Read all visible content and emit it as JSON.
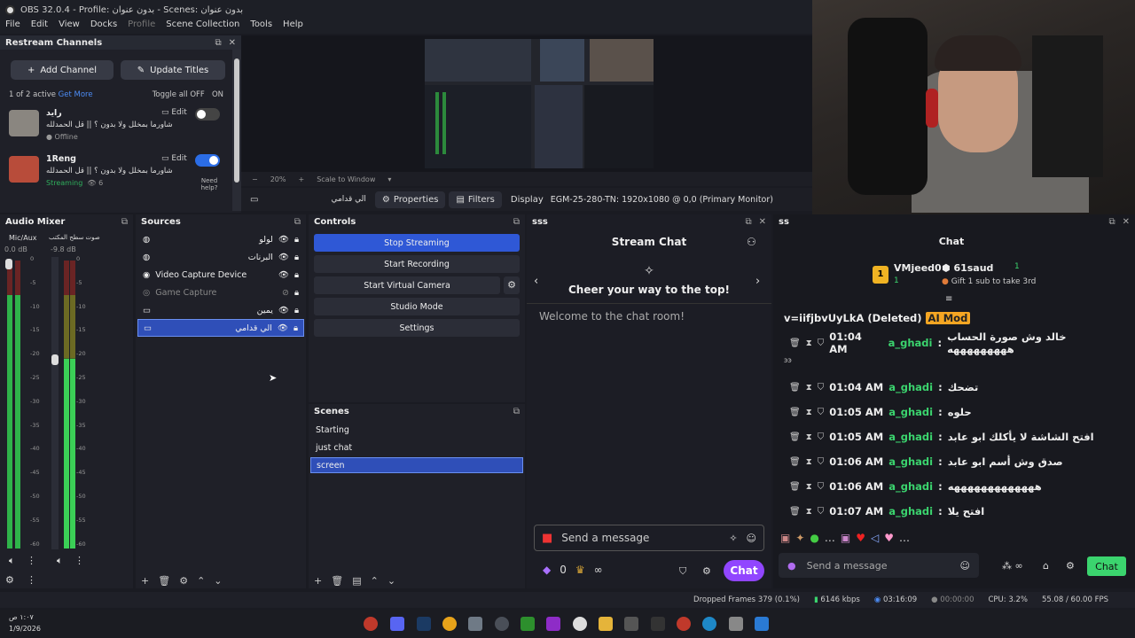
{
  "window": {
    "title": "OBS 32.0.4 - Profile: بدون عنوان - Scenes: بدون عنوان"
  },
  "menu": [
    "File",
    "Edit",
    "View",
    "Docks",
    "Profile",
    "Scene Collection",
    "Tools",
    "Help"
  ],
  "restream": {
    "title": "Restream Channels",
    "add_channel": "Add Channel",
    "update_titles": "Update Titles",
    "active_text": "1 of 2 active",
    "get_more": "Get More",
    "toggle_all": "Toggle all OFF",
    "toggle_on": "ON",
    "channels": [
      {
        "name": "رايد",
        "title": "شاورما بمخلل ولا بدون ؟ || قل الحمدلله",
        "status": "Offline",
        "edit": "Edit",
        "on": false
      },
      {
        "name": "1Reng",
        "title": "شاورما بمخلل ولا بدون ؟ || قل الحمدلله",
        "status": "Streaming",
        "viewers": "6",
        "edit": "Edit",
        "on": true,
        "help": "Need help?"
      }
    ]
  },
  "preview": {
    "zoom": "20%",
    "scale": "Scale to Window",
    "source_name": "الي قدامي",
    "properties": "Properties",
    "filters": "Filters",
    "display_label": "Display",
    "display_value": "EGM-25-280-TN: 1920x1080 @ 0,0 (Primary Monitor)"
  },
  "audio_mixer": {
    "title": "Audio Mixer",
    "channels": [
      {
        "name": "Mic/Aux",
        "db": "0.0 dB",
        "level": 0.88
      },
      {
        "name": "صوت سطح المكتب",
        "db": "-9.8 dB",
        "level": 0.66
      }
    ],
    "scale": [
      "0",
      "-5",
      "-10",
      "-15",
      "-20",
      "-25",
      "-30",
      "-35",
      "-40",
      "-45",
      "-50",
      "-55",
      "-60"
    ]
  },
  "sources": {
    "title": "Sources",
    "items": [
      {
        "label": "لولو",
        "icon": "globe",
        "hidden": false
      },
      {
        "label": "البرنات",
        "icon": "globe",
        "hidden": false
      },
      {
        "label": "Video Capture Device",
        "icon": "camera",
        "hidden": false
      },
      {
        "label": "Game Capture",
        "icon": "gamepad",
        "hidden": true
      },
      {
        "label": "يمين",
        "icon": "monitor",
        "hidden": false
      },
      {
        "label": "الي قدامي",
        "icon": "monitor",
        "hidden": false,
        "selected": true
      }
    ]
  },
  "controls": {
    "title": "Controls",
    "buttons": [
      "Stop Streaming",
      "Start Recording",
      "Start Virtual Camera",
      "Studio Mode",
      "Settings"
    ]
  },
  "scenes": {
    "title": "Scenes",
    "items": [
      {
        "label": "Starting"
      },
      {
        "label": "just chat"
      },
      {
        "label": "screen",
        "selected": true
      }
    ]
  },
  "sss": {
    "title": "sss",
    "header": "Stream Chat",
    "cheer": "Cheer your way to the top!",
    "welcome": "Welcome to the chat room!",
    "input_placeholder": "Send a message",
    "points": "0",
    "infinity": "∞",
    "chat_button": "Chat"
  },
  "ss": {
    "title": "ss",
    "header": "Chat",
    "top_user": "VMjeed0",
    "top_user_count": "1",
    "second_user": "61saud",
    "second_count": "1",
    "gift_text": "Gift 1 sub to take 3rd",
    "deleted": "v=iifjbvUyLkA (Deleted)",
    "ai_mod": "AI Mod",
    "messages": [
      {
        "time": "01:04 AM",
        "user": "a_ghadi",
        "text": "خالد وش صورة الحساب هههههههههه"
      },
      {
        "time": "01:04 AM",
        "user": "a_ghadi",
        "text": "تضحك"
      },
      {
        "time": "01:05 AM",
        "user": "a_ghadi",
        "text": "حلوه"
      },
      {
        "time": "01:05 AM",
        "user": "a_ghadi",
        "text": "افتح الشاشة لا يأكلك ابو عابد"
      },
      {
        "time": "01:06 AM",
        "user": "a_ghadi",
        "text": "صدق وش أسم ابو عابد"
      },
      {
        "time": "01:06 AM",
        "user": "a_ghadi",
        "text": "هههههههههههههه"
      },
      {
        "time": "01:07 AM",
        "user": "a_ghadi",
        "text": "افتح يلا"
      }
    ],
    "input_placeholder": "Send a message",
    "infinity": "∞",
    "chat_button": "Chat"
  },
  "statusbar": {
    "dropped": "Dropped Frames 379 (0.1%)",
    "kbps": "6146 kbps",
    "live_time": "03:16:09",
    "rec_time": "00:00:00",
    "cpu": "CPU: 3.2%",
    "fps": "55.08 / 60.00 FPS"
  },
  "clock": {
    "time": "١:٠٧ ص",
    "date": "1/9/2026"
  },
  "colors": {
    "accent_blue": "#2f58d6",
    "chat_purple": "#9146ff",
    "chat_green": "#3bd46e",
    "ai_mod": "#f5a623"
  }
}
